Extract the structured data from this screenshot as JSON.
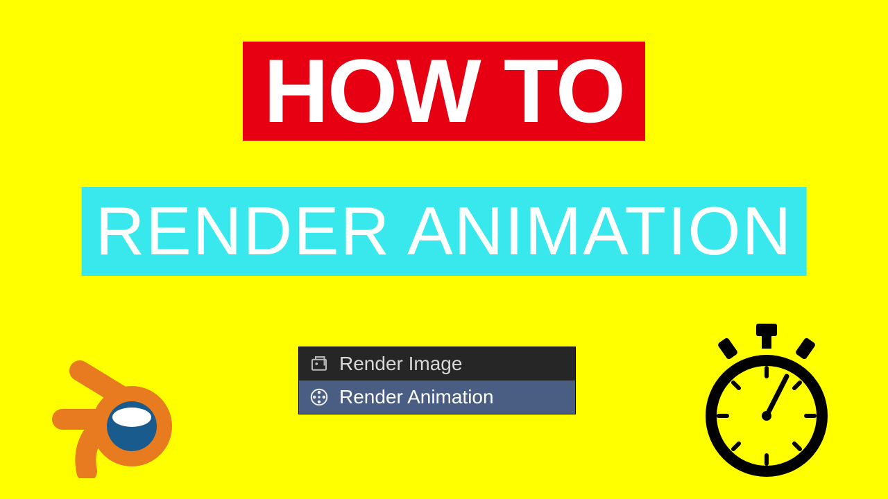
{
  "title": {
    "line1": "HOW TO",
    "line2": "RENDER ANIMATION"
  },
  "menu": {
    "item1": "Render Image",
    "item2": "Render Animation"
  },
  "icons": {
    "blender": "blender-logo-icon",
    "stopwatch": "stopwatch-icon",
    "render_image": "render-image-icon",
    "render_animation": "render-animation-icon"
  }
}
